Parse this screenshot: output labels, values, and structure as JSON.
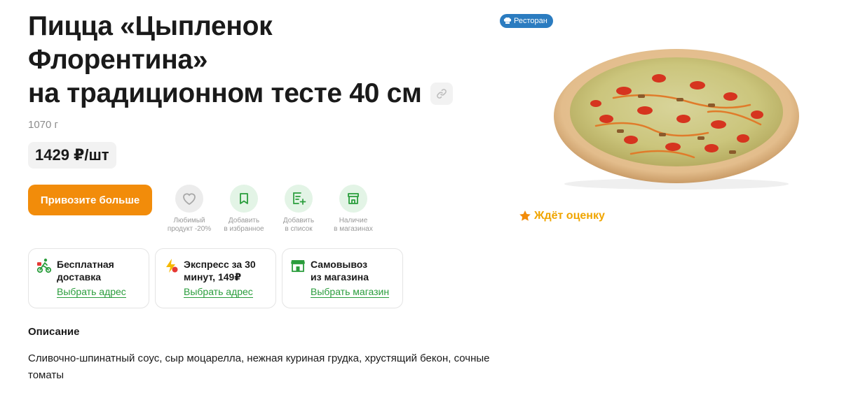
{
  "product": {
    "title_line1": "Пицца «Цыпленок",
    "title_line2": "Флорентина»",
    "title_line3": "на традиционном тесте 40 см",
    "weight": "1070 г",
    "price": "1429 ₽/шт",
    "badge": "Ресторан",
    "rating_text": "Ждёт оценку"
  },
  "actions": {
    "cta_label": "Привозите больше",
    "favorite_label": [
      "Любимый",
      "продукт -20%"
    ],
    "bookmark_label": [
      "Добавить",
      "в избранное"
    ],
    "list_label": [
      "Добавить",
      "в список"
    ],
    "stores_label": [
      "Наличие",
      "в магазинах"
    ]
  },
  "delivery": [
    {
      "title": [
        "Бесплатная",
        "доставка"
      ],
      "link": "Выбрать адрес",
      "icon": "courier-icon"
    },
    {
      "title": [
        "Экспресс за 30",
        "минут, 149₽"
      ],
      "link": "Выбрать адрес",
      "icon": "lightning-icon"
    },
    {
      "title": [
        "Самовывоз",
        "из магазина"
      ],
      "link": "Выбрать магазин",
      "icon": "store-icon"
    }
  ],
  "description": {
    "heading": "Описание",
    "text": "Сливочно-шпинатный соус, сыр моцарелла, нежная куриная грудка, хрустящий бекон, сочные томаты"
  },
  "colors": {
    "accent": "#f28c0a",
    "green": "#2a9d3c",
    "badge": "#2b7cc0",
    "rating": "#f0a500"
  }
}
